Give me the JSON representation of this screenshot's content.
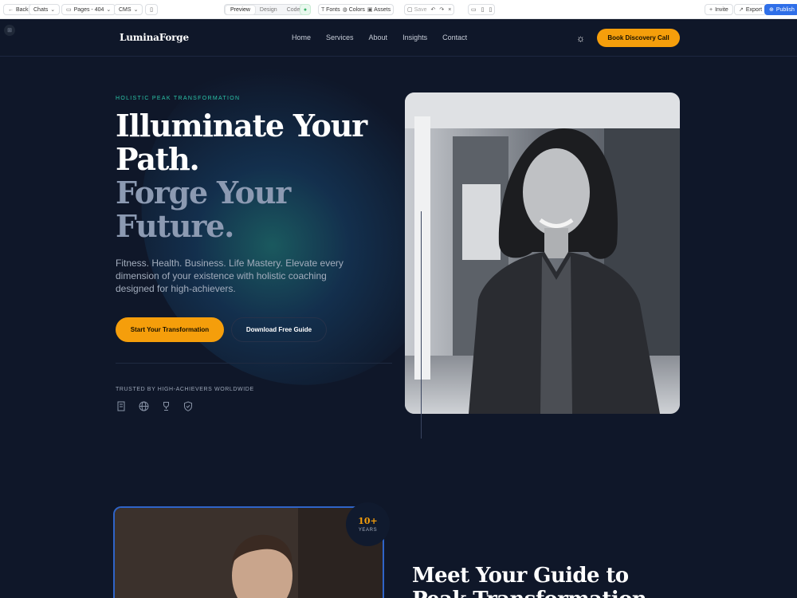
{
  "editor": {
    "back": "Back",
    "chats": "Chats",
    "pages": "Pages - 404",
    "cms": "CMS",
    "modes": [
      "Preview",
      "Design",
      "Code"
    ],
    "active_mode": "Preview",
    "fonts": "Fonts",
    "colors": "Colors",
    "assets": "Assets",
    "save": "Save",
    "invite": "Invite",
    "export": "Export",
    "publish": "Publish"
  },
  "site": {
    "logo": "LuminaForge",
    "nav": [
      "Home",
      "Services",
      "About",
      "Insights",
      "Contact"
    ],
    "nav_cta": "Book Discovery Call",
    "hero": {
      "eyebrow": "HOLISTIC PEAK TRANSFORMATION",
      "title_line1a": "Illuminate Your",
      "title_line1b": "Path.",
      "title_line2a": "Forge Your",
      "title_line2b": "Future.",
      "lede": "Fitness. Health. Business. Life Mastery. Elevate every dimension of your existence with holistic coaching designed for high-achievers.",
      "primary_cta": "Start Your Transformation",
      "secondary_cta": "Download Free Guide",
      "trusted": "TRUSTED BY HIGH-ACHIEVERS WORLDWIDE"
    },
    "guide": {
      "badge_num": "10+",
      "badge_label": "YEARS",
      "heading": "Meet Your Guide to Peak Transformation"
    }
  },
  "colors": {
    "accent": "#f59e0b",
    "teal": "#2bc2a6",
    "bg": "#0f1729",
    "publish": "#2f6fe8"
  }
}
